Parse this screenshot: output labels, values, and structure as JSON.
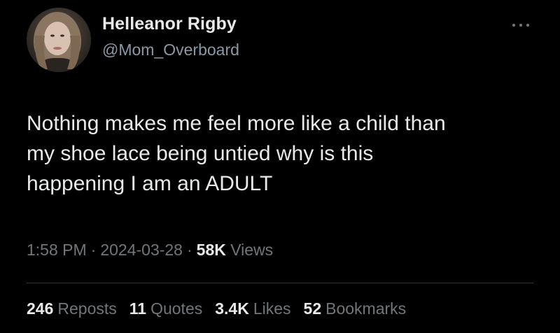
{
  "author": {
    "display_name": "Helleanor Rigby",
    "handle": "@Mom_Overboard",
    "avatar_icon": "profile-photo-avatar"
  },
  "more_menu": {
    "icon": "more-options-icon"
  },
  "tweet": {
    "lines": [
      "Nothing makes me feel more like a child than",
      "my shoe lace being untied why is this",
      "happening I am an ADULT"
    ]
  },
  "meta": {
    "time": "1:58 PM",
    "separator": "·",
    "date": "2024-03-28",
    "views_count": "58K",
    "views_label": "Views"
  },
  "stats": {
    "reposts": {
      "count": "246",
      "label": "Reposts"
    },
    "quotes": {
      "count": "11",
      "label": "Quotes"
    },
    "likes": {
      "count": "3.4K",
      "label": "Likes"
    },
    "bookmarks": {
      "count": "52",
      "label": "Bookmarks"
    }
  },
  "colors": {
    "background": "#000000",
    "primary_text": "#e7e9ea",
    "secondary_text": "#71767b",
    "divider": "#2f3336"
  }
}
